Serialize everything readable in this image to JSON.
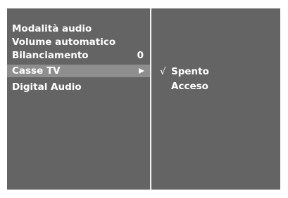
{
  "menu": {
    "items": [
      {
        "label": "Modalità audio",
        "value": ""
      },
      {
        "label": "Volume automatico",
        "value": ""
      },
      {
        "label": "Bilanciamento",
        "value": "0"
      },
      {
        "label": "Casse TV",
        "value": "",
        "selected": true,
        "submenu_icon": "right-triangle-icon"
      },
      {
        "label": "Digital Audio",
        "value": ""
      }
    ]
  },
  "submenu": {
    "check_mark": "√",
    "options": [
      {
        "label": "Spento",
        "checked": true
      },
      {
        "label": "Acceso",
        "checked": false
      }
    ]
  },
  "colors": {
    "panel_bg": "#646464",
    "highlight_bg": "#8e8e8e",
    "divider": "#f2f2f2",
    "text": "#ffffff"
  }
}
